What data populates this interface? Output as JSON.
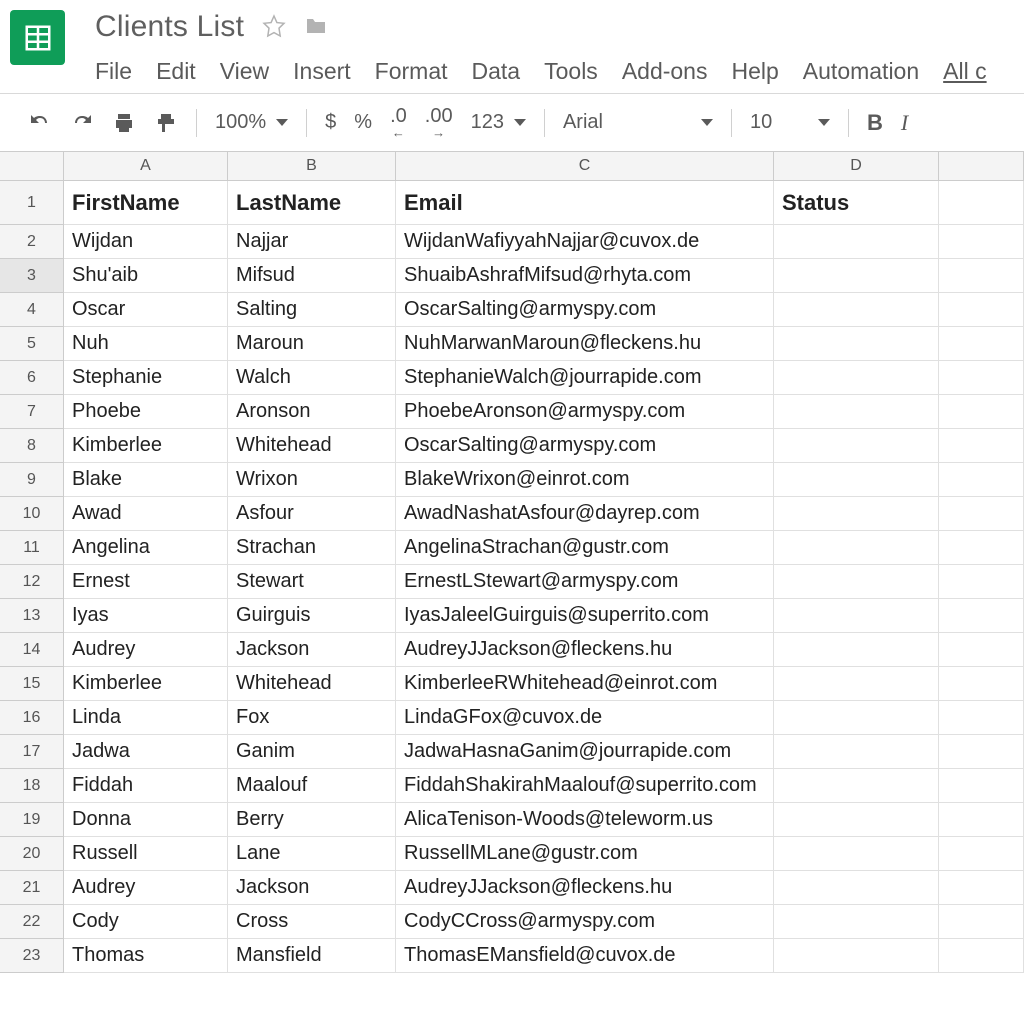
{
  "doc": {
    "title": "Clients List"
  },
  "menubar": [
    "File",
    "Edit",
    "View",
    "Insert",
    "Format",
    "Data",
    "Tools",
    "Add-ons",
    "Help",
    "Automation",
    "All c"
  ],
  "toolbar": {
    "zoom": "100%",
    "currency": "$",
    "percent": "%",
    "dec_less": ".0",
    "dec_more": ".00",
    "num_fmt": "123",
    "font_name": "Arial",
    "font_size": "10",
    "bold": "B",
    "italic": "I"
  },
  "columns": [
    "A",
    "B",
    "C",
    "D",
    ""
  ],
  "sheet": {
    "headers": [
      "FirstName",
      "LastName",
      "Email",
      "Status"
    ],
    "rows": [
      {
        "n": "1",
        "a": "FirstName",
        "b": "LastName",
        "c": "Email",
        "d": "Status",
        "hdr": true
      },
      {
        "n": "2",
        "a": "Wijdan",
        "b": "Najjar",
        "c": "WijdanWafiyyahNajjar@cuvox.de",
        "d": ""
      },
      {
        "n": "3",
        "a": "Shu'aib",
        "b": "Mifsud",
        "c": "ShuaibAshrafMifsud@rhyta.com",
        "d": "",
        "sel": true
      },
      {
        "n": "4",
        "a": "Oscar",
        "b": "Salting",
        "c": "OscarSalting@armyspy.com",
        "d": ""
      },
      {
        "n": "5",
        "a": "Nuh",
        "b": "Maroun",
        "c": "NuhMarwanMaroun@fleckens.hu",
        "d": ""
      },
      {
        "n": "6",
        "a": "Stephanie",
        "b": "Walch",
        "c": "StephanieWalch@jourrapide.com",
        "d": ""
      },
      {
        "n": "7",
        "a": "Phoebe",
        "b": "Aronson",
        "c": "PhoebeAronson@armyspy.com",
        "d": ""
      },
      {
        "n": "8",
        "a": "Kimberlee",
        "b": "Whitehead",
        "c": "OscarSalting@armyspy.com",
        "d": ""
      },
      {
        "n": "9",
        "a": "Blake",
        "b": "Wrixon",
        "c": "BlakeWrixon@einrot.com",
        "d": ""
      },
      {
        "n": "10",
        "a": "Awad",
        "b": "Asfour",
        "c": "AwadNashatAsfour@dayrep.com",
        "d": ""
      },
      {
        "n": "11",
        "a": "Angelina",
        "b": "Strachan",
        "c": "AngelinaStrachan@gustr.com",
        "d": ""
      },
      {
        "n": "12",
        "a": "Ernest",
        "b": "Stewart",
        "c": "ErnestLStewart@armyspy.com",
        "d": ""
      },
      {
        "n": "13",
        "a": "Iyas",
        "b": "Guirguis",
        "c": "IyasJaleelGuirguis@superrito.com",
        "d": ""
      },
      {
        "n": "14",
        "a": "Audrey",
        "b": "Jackson",
        "c": "AudreyJJackson@fleckens.hu",
        "d": ""
      },
      {
        "n": "15",
        "a": "Kimberlee",
        "b": "Whitehead",
        "c": "KimberleeRWhitehead@einrot.com",
        "d": ""
      },
      {
        "n": "16",
        "a": "Linda",
        "b": "Fox",
        "c": "LindaGFox@cuvox.de",
        "d": ""
      },
      {
        "n": "17",
        "a": "Jadwa",
        "b": "Ganim",
        "c": "JadwaHasnaGanim@jourrapide.com",
        "d": ""
      },
      {
        "n": "18",
        "a": "Fiddah",
        "b": "Maalouf",
        "c": "FiddahShakirahMaalouf@superrito.com",
        "d": ""
      },
      {
        "n": "19",
        "a": "Donna",
        "b": "Berry",
        "c": "AlicaTenison-Woods@teleworm.us",
        "d": ""
      },
      {
        "n": "20",
        "a": "Russell",
        "b": "Lane",
        "c": "RussellMLane@gustr.com",
        "d": ""
      },
      {
        "n": "21",
        "a": "Audrey",
        "b": "Jackson",
        "c": "AudreyJJackson@fleckens.hu",
        "d": ""
      },
      {
        "n": "22",
        "a": "Cody",
        "b": "Cross",
        "c": "CodyCCross@armyspy.com",
        "d": ""
      },
      {
        "n": "23",
        "a": "Thomas",
        "b": "Mansfield",
        "c": "ThomasEMansfield@cuvox.de",
        "d": ""
      }
    ]
  }
}
